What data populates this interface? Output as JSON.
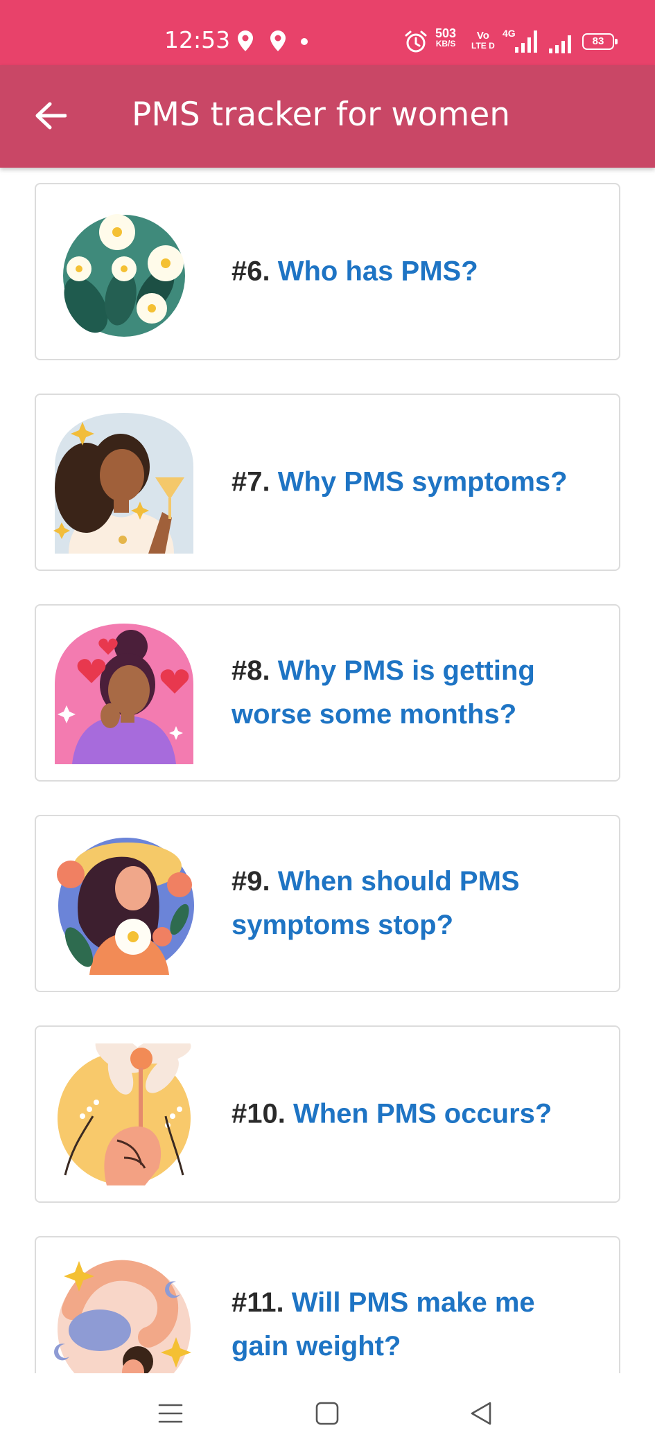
{
  "status_bar": {
    "time": "12:53",
    "net_speed_value": "503",
    "net_speed_unit": "KB/S",
    "volte_top": "Vo",
    "volte_bottom": "LTE D",
    "network_type": "4G",
    "battery": "83"
  },
  "app_bar": {
    "title": "PMS tracker for women"
  },
  "articles": [
    {
      "number": "#6.",
      "title": "Who has PMS?",
      "illustration": "daisy-flowers"
    },
    {
      "number": "#7.",
      "title": "Why PMS symptoms?",
      "illustration": "woman-with-drink"
    },
    {
      "number": "#8.",
      "title": "Why PMS is getting worse some months?",
      "illustration": "woman-with-hearts"
    },
    {
      "number": "#9.",
      "title": "When should PMS symptoms stop?",
      "illustration": "woman-with-hat-and-flowers"
    },
    {
      "number": "#10.",
      "title": "When PMS occurs?",
      "illustration": "hand-holding-daisy"
    },
    {
      "number": "#11.",
      "title": "Will PMS make me gain weight?",
      "illustration": "yoga-pose"
    }
  ],
  "colors": {
    "status_bar": "#e8426a",
    "app_bar": "#c94766",
    "title_link": "#1e74c4",
    "number_text": "#2a2a2a"
  },
  "icons": [
    "location-pin-icon",
    "alarm-icon",
    "signal-icon",
    "battery-icon",
    "back-arrow-icon",
    "menu-icon",
    "home-icon",
    "back-triangle-icon"
  ]
}
